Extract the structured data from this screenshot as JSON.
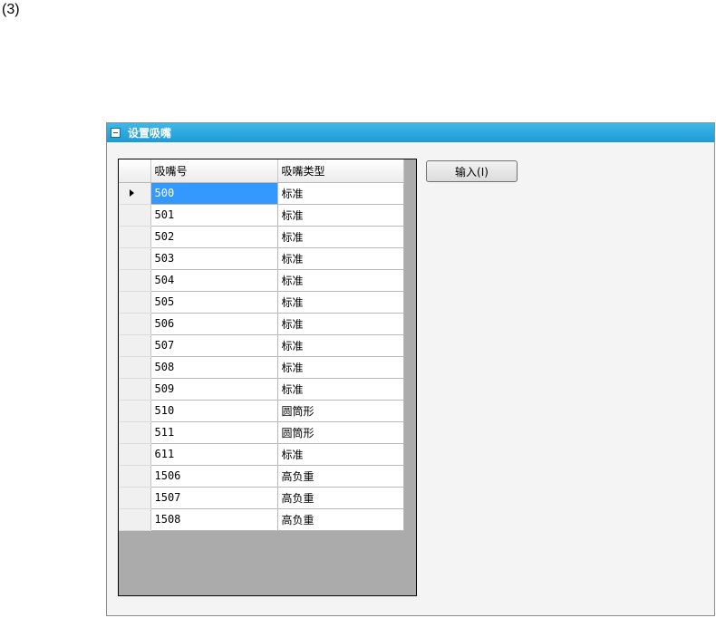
{
  "figure_label": "(3)",
  "panel": {
    "title": "设置吸嘴",
    "accent_color": "#1e9ad4"
  },
  "grid": {
    "columns": [
      "吸嘴号",
      "吸嘴类型"
    ],
    "selected_row": 0,
    "rows": [
      {
        "nozzle": "500",
        "type": "标准"
      },
      {
        "nozzle": "501",
        "type": "标准"
      },
      {
        "nozzle": "502",
        "type": "标准"
      },
      {
        "nozzle": "503",
        "type": "标准"
      },
      {
        "nozzle": "504",
        "type": "标准"
      },
      {
        "nozzle": "505",
        "type": "标准"
      },
      {
        "nozzle": "506",
        "type": "标准"
      },
      {
        "nozzle": "507",
        "type": "标准"
      },
      {
        "nozzle": "508",
        "type": "标准"
      },
      {
        "nozzle": "509",
        "type": "标准"
      },
      {
        "nozzle": "510",
        "type": "圆筒形"
      },
      {
        "nozzle": "511",
        "type": "圆筒形"
      },
      {
        "nozzle": "611",
        "type": "标准"
      },
      {
        "nozzle": "1506",
        "type": "高负重"
      },
      {
        "nozzle": "1507",
        "type": "高负重"
      },
      {
        "nozzle": "1508",
        "type": "高负重"
      }
    ]
  },
  "input_button": {
    "label": "输入(I)"
  }
}
